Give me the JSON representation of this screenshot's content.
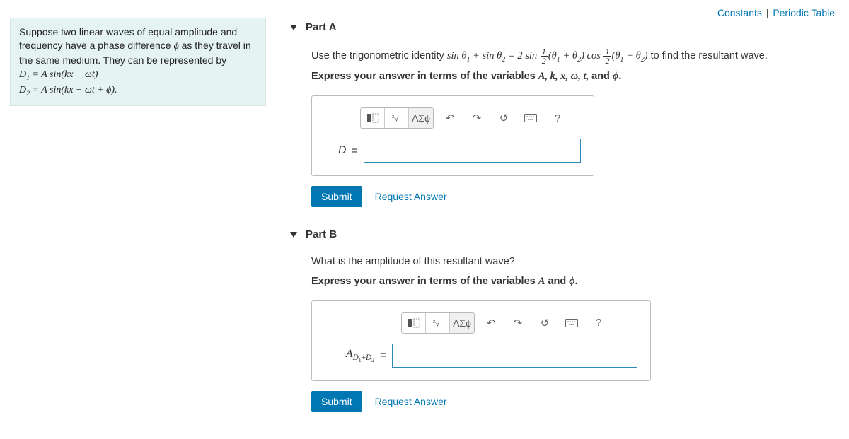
{
  "topLinks": {
    "constants": "Constants",
    "periodic": "Periodic Table",
    "sep": "|"
  },
  "prompt": {
    "intro": "Suppose two linear waves of equal amplitude and frequency have a phase difference ",
    "phi": "ϕ",
    "intro2": " as they travel in the same medium. They can be represented by",
    "eq1_lhs": "D₁",
    "eq1_rhs": "A sin(kx − ωt)",
    "eq2_lhs": "D₂",
    "eq2_rhs": "A sin(kx − ωt + ϕ)",
    "equals": " = ",
    "period": "."
  },
  "partA": {
    "title": "Part A",
    "instr_pre": "Use the trigonometric identity ",
    "identity": "sin θ₁ + sin θ₂ = 2 sin ½(θ₁ + θ₂) cos ½(θ₁ − θ₂)",
    "instr_post": " to find the resultant wave.",
    "instr_bold_pre": "Express your answer in terms of the variables ",
    "vars_bold": "A, k, x, ω, t,",
    "instr_bold_and": " and ",
    "var_phi": "ϕ",
    "instr_bold_post": ".",
    "lhs": "D",
    "eq": "=",
    "submit": "Submit",
    "request": "Request Answer"
  },
  "partB": {
    "title": "Part B",
    "instr": "What is the amplitude of this resultant wave?",
    "instr_bold_pre": "Express your answer in terms of the variables ",
    "var_A": "A",
    "instr_bold_and": " and ",
    "var_phi": "ϕ",
    "instr_bold_post": ".",
    "lhs_html": "A_{D₁+D₂}",
    "eq": "=",
    "submit": "Submit",
    "request": "Request Answer"
  },
  "toolbar": {
    "templates": "templates-icon",
    "sqrt": "x√",
    "greek": "ΑΣϕ",
    "undo": "↶",
    "redo": "↷",
    "reset": "↺",
    "keyboard": "⌨",
    "help": "?"
  }
}
